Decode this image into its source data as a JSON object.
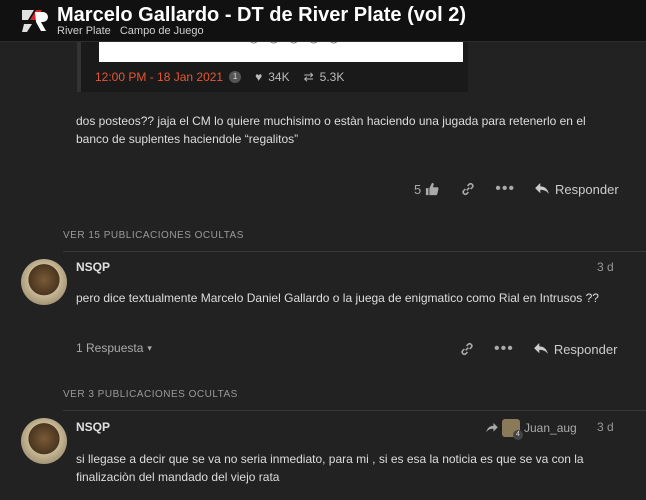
{
  "header": {
    "title": "Marcelo Gallardo - DT de River Plate (vol 2)",
    "breadcrumbs": [
      "River Plate",
      "Campo de Juego"
    ]
  },
  "tweet": {
    "timestamp": "12:00 PM - 18 Jan 2021",
    "count": "1",
    "likes": "34K",
    "retweets": "5.3K"
  },
  "post1": {
    "text": "dos posteos?? jaja el CM lo quiere muchisimo o estàn haciendo una jugada para retenerlo en el banco de suplentes haciendole “regalitos”",
    "like_count": "5",
    "reply_label": "Responder"
  },
  "hidden1": "VER 15 PUBLICACIONES OCULTAS",
  "post2": {
    "username": "NSQP",
    "date": "3 d",
    "text": "pero dice textualmente Marcelo Daniel Gallardo o la juega de enigmatico como Rial en Intrusos ??",
    "replies_label": "1 Respuesta",
    "reply_label": "Responder"
  },
  "hidden2": "VER 3 PUBLICACIONES OCULTAS",
  "post3": {
    "username": "NSQP",
    "date": "3 d",
    "reply_to_user": "Juan_aug",
    "reply_to_badge": "4",
    "text": "si llegase a decir que se va no seria inmediato, para mi , si es esa la noticia es que se va con la finalizaciòn del mandado del viejo rata"
  },
  "colors": {
    "background": "#222222",
    "header": "#111111",
    "accent": "#e45735"
  }
}
